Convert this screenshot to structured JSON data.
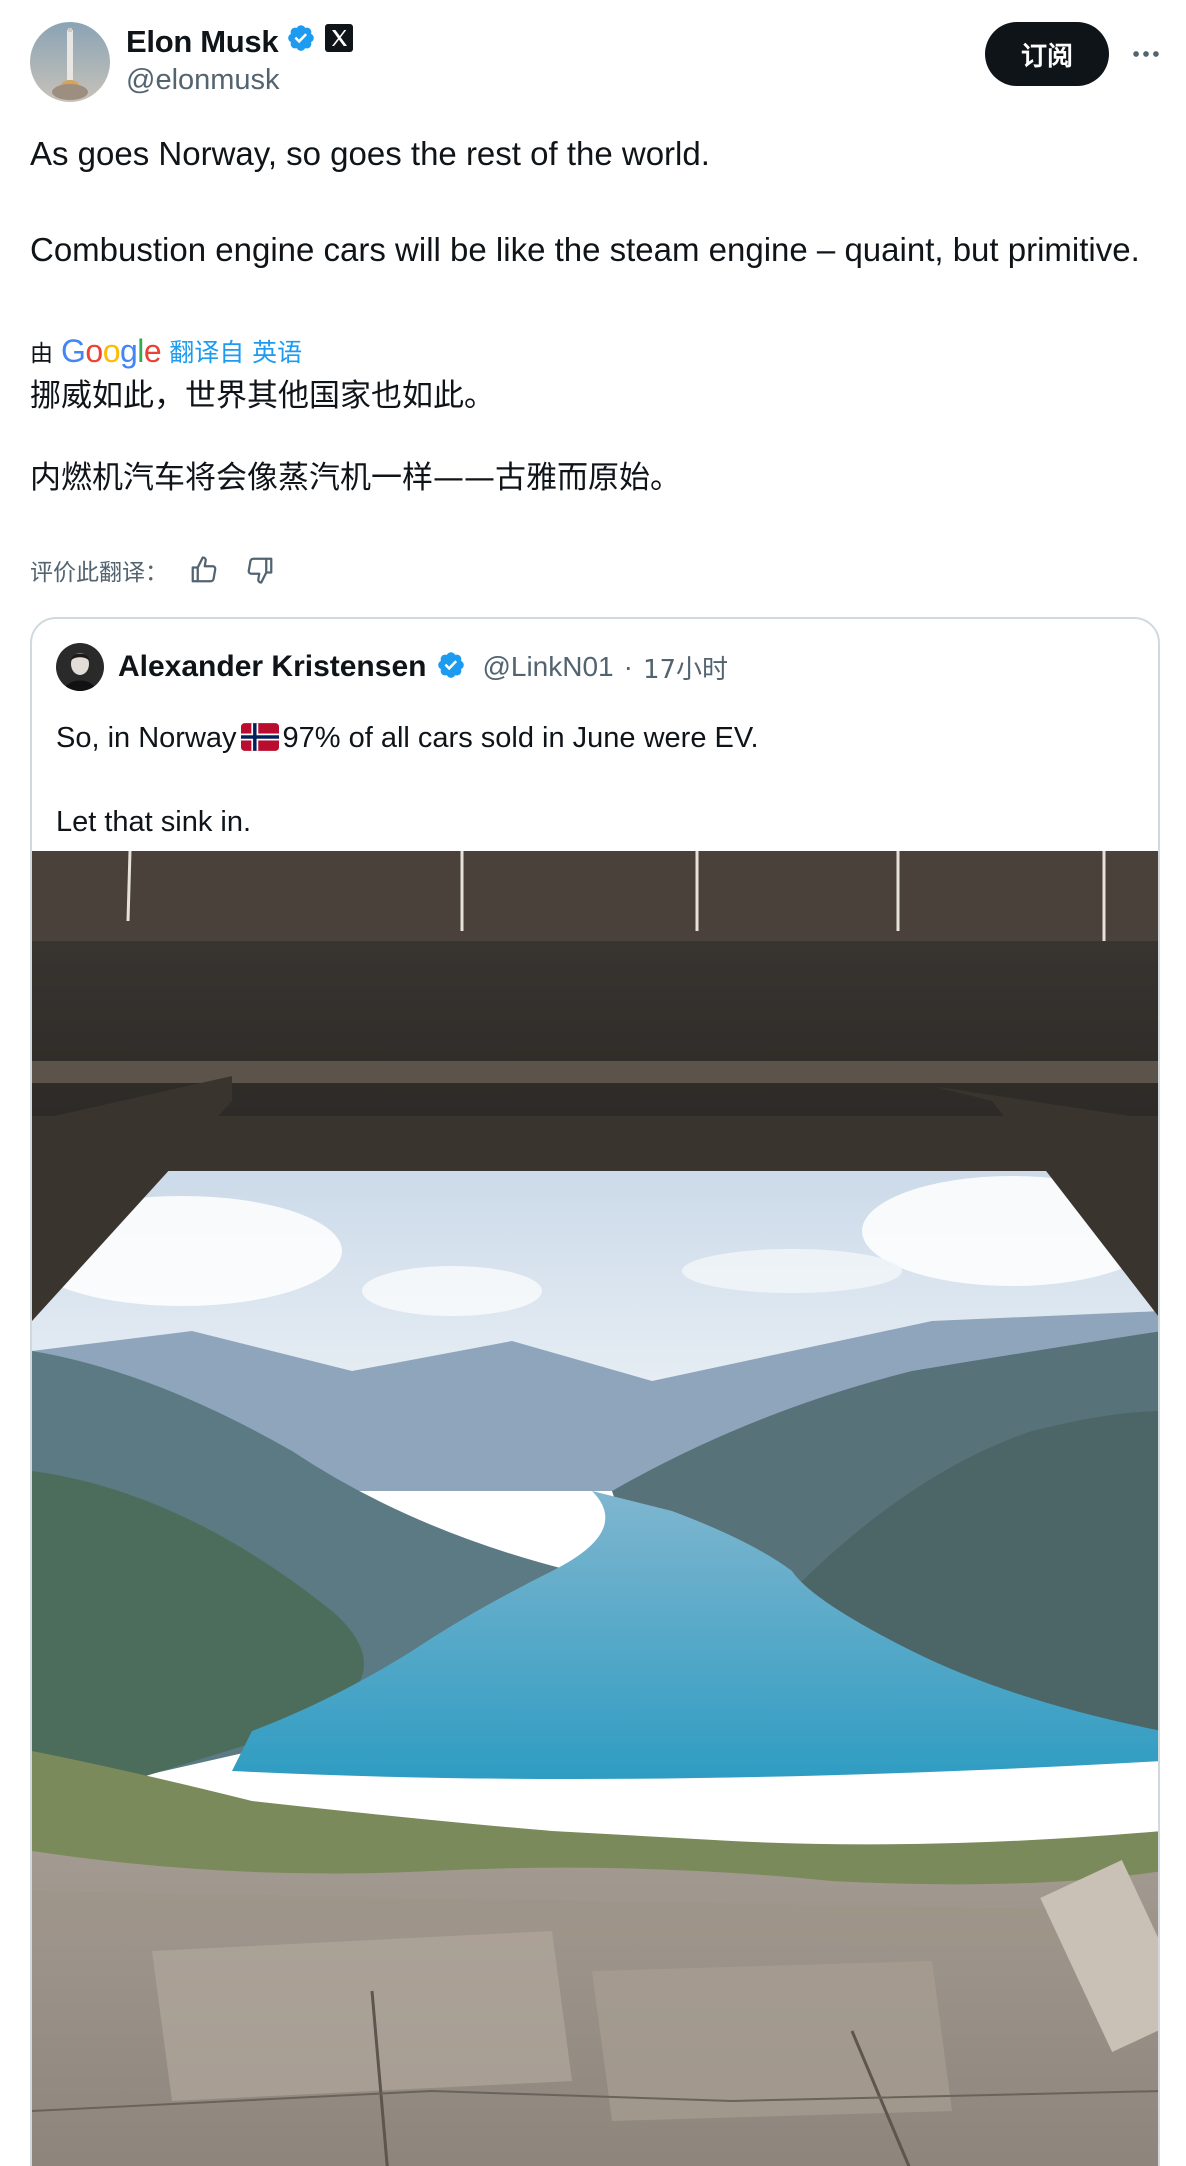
{
  "author": {
    "name": "Elon Musk",
    "handle": "@elonmusk",
    "verified": true,
    "affiliate_badge": "x-logo-badge-icon"
  },
  "header": {
    "follow_label": "订阅",
    "more_icon": "more-horizontal-icon"
  },
  "tweet": {
    "line1": "As goes Norway, so goes the rest of the world.",
    "line2": "Combustion engine cars will be like the steam engine – quaint, but primitive."
  },
  "translation": {
    "by_prefix": "由",
    "google_logo": "Google",
    "link": "翻译自 英语",
    "line1": "挪威如此，世界其他国家也如此。",
    "line2": "内燃机汽车将会像蒸汽机一样——古雅而原始。",
    "rate_label": "评价此翻译："
  },
  "quote": {
    "name": "Alexander Kristensen",
    "handle": "@LinkN01",
    "separator": "·",
    "time": "17小时",
    "text_before_flag": "So, in Norway",
    "text_after_flag": "97% of all cars sold in June were EV.",
    "text_line2": "Let that sink in.",
    "flag_icon": "norway-flag-icon",
    "media_subject": "fjord-landscape-photo"
  },
  "colors": {
    "text": "#0f1419",
    "secondary": "#536471",
    "link": "#1d9bf0",
    "verified": "#1d9bf0",
    "border": "#cfd9de",
    "button_bg": "#0f1419"
  }
}
